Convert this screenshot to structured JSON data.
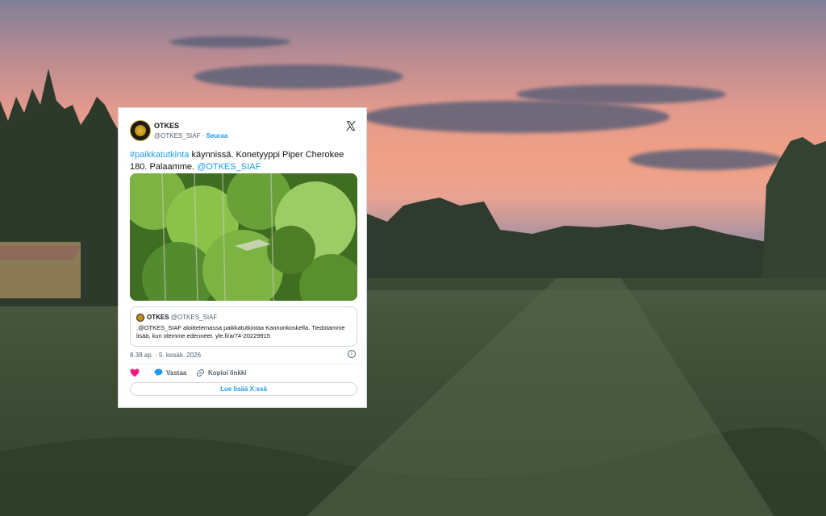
{
  "tweet": {
    "author_name": "OTKES",
    "author_handle": "@OTKES_SIAF",
    "separator": "·",
    "follow_label": "Seuraa",
    "hashtag": "#paikkatutkinta",
    "text_part1": " käynnissä. Konetyyppi Piper Cherokee 180. Palaamme. ",
    "mention": "@OTKES_SIAF",
    "timestamp": "8.38 ap. · 5. kesäk. 2026",
    "info_glyph": "i",
    "quote": {
      "author_name": "OTKES",
      "author_handle": "@OTKES_SIAF",
      "text": ".@OTKES_SIAF aloittelemassa paikkatutkintaa Kannonkoskella. Tiedotamme lisää, kun olemme edenneet.  yle.fi/a/74-20229915"
    },
    "actions": {
      "like_icon": "heart-icon",
      "reply_label": "Vastaa",
      "copy_label": "Kopioi linkki"
    },
    "read_more_label": "Lue lisää X:ssä"
  },
  "colors": {
    "accent": "#1d9bf0",
    "like": "#f91880",
    "text": "#0f1419",
    "muted": "#536471"
  }
}
